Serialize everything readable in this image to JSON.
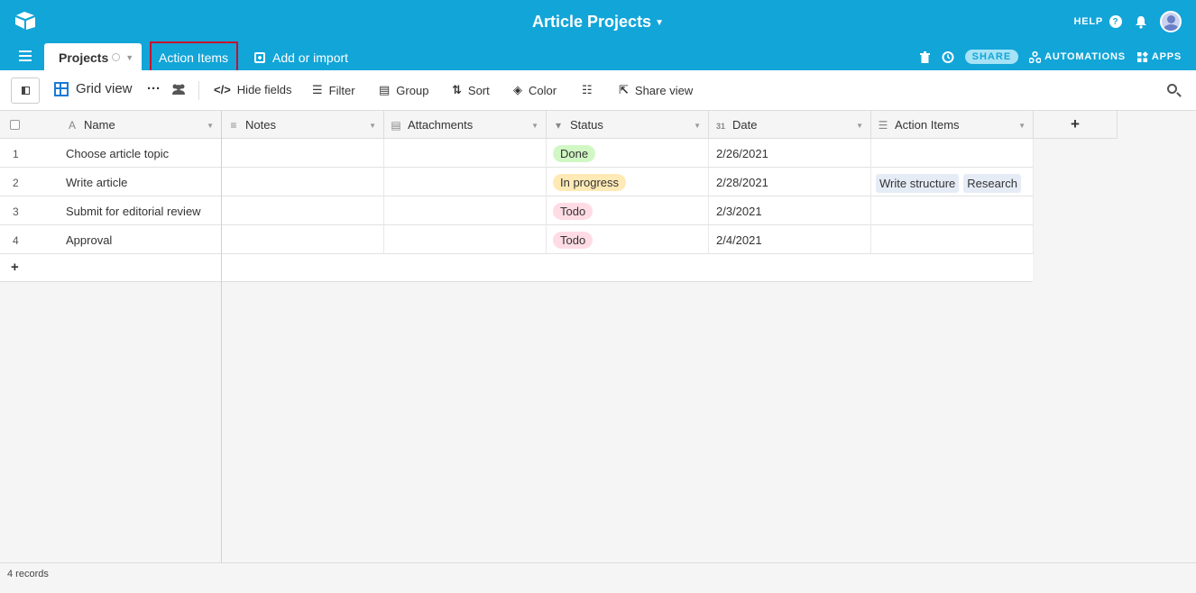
{
  "base": {
    "title": "Article Projects"
  },
  "topbar": {
    "help": "HELP",
    "help_icon": "?"
  },
  "tabs": [
    {
      "label": "Projects"
    },
    {
      "label": "Action Items"
    }
  ],
  "add_import": "Add or import",
  "tabrow_right": {
    "share": "SHARE",
    "automations": "AUTOMATIONS",
    "apps": "APPS"
  },
  "toolbar": {
    "view_name": "Grid view",
    "more": "···",
    "hide_fields": "Hide fields",
    "filter": "Filter",
    "group": "Group",
    "sort": "Sort",
    "color": "Color",
    "share_view": "Share view"
  },
  "columns": [
    {
      "label": "Name",
      "icon": "A"
    },
    {
      "label": "Notes",
      "icon": "≡"
    },
    {
      "label": "Attachments",
      "icon": "▤"
    },
    {
      "label": "Status",
      "icon": "▾"
    },
    {
      "label": "Date",
      "icon": "31"
    },
    {
      "label": "Action Items",
      "icon": "☰"
    }
  ],
  "add_column": "+",
  "rows": [
    {
      "num": "1",
      "name": "Choose article topic",
      "status": "Done",
      "date": "2/26/2021",
      "action_items": []
    },
    {
      "num": "2",
      "name": "Write article",
      "status": "In progress",
      "date": "2/28/2021",
      "action_items": [
        "Write structure",
        "Research"
      ]
    },
    {
      "num": "3",
      "name": "Submit for editorial review",
      "status": "Todo",
      "date": "2/3/2021",
      "action_items": []
    },
    {
      "num": "4",
      "name": "Approval",
      "status": "Todo",
      "date": "2/4/2021",
      "action_items": []
    }
  ],
  "add_row": "+",
  "footer": {
    "records": "4 records"
  },
  "colors": {
    "topbar": "#12a5d8",
    "status_done": "#d1f7c4",
    "status_in_progress": "#ffeab6",
    "status_todo": "#ffdce5",
    "highlight_border": "#c8102e"
  }
}
